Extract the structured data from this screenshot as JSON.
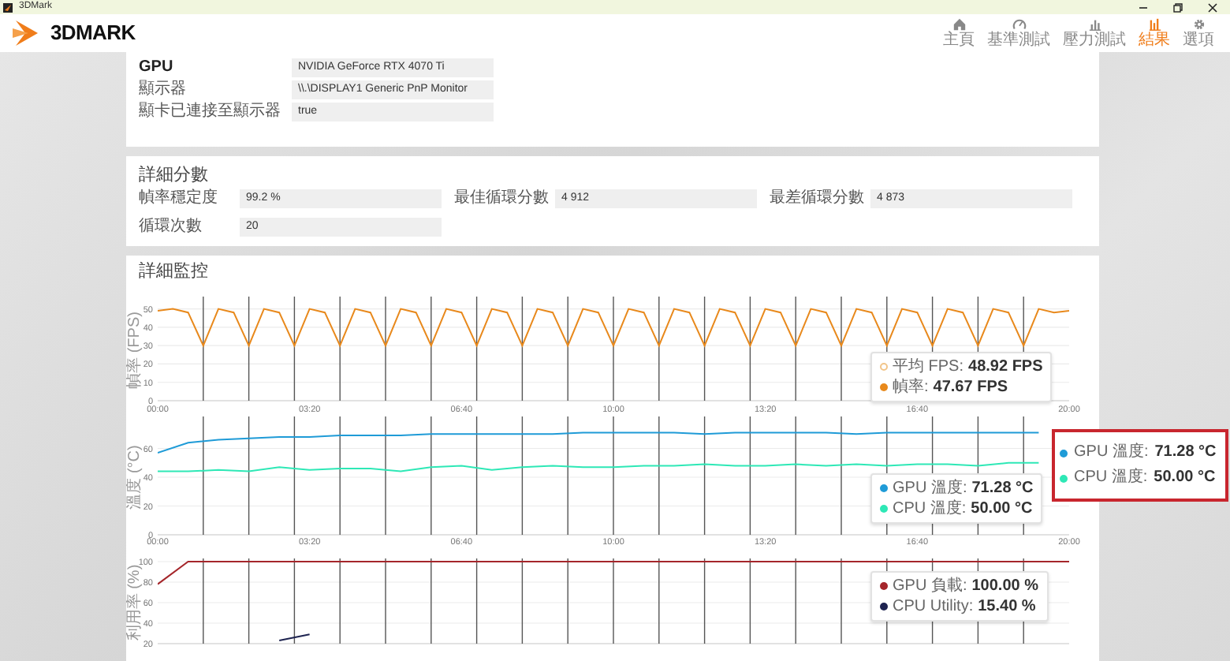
{
  "window": {
    "title": "3DMark"
  },
  "app": {
    "logo": "3DMARK"
  },
  "nav": [
    {
      "label": "主頁",
      "selected": false
    },
    {
      "label": "基準測試",
      "selected": false
    },
    {
      "label": "壓力測試",
      "selected": false
    },
    {
      "label": "結果",
      "selected": true
    },
    {
      "label": "選項",
      "selected": false
    }
  ],
  "system_info": [
    {
      "label": "GPU",
      "bold": true,
      "value": "NVIDIA GeForce RTX 4070 Ti"
    },
    {
      "label": "顯示器",
      "bold": false,
      "value": "\\\\.\\DISPLAY1 Generic PnP Monitor"
    },
    {
      "label": "顯卡已連接至顯示器",
      "bold": false,
      "value": "true"
    }
  ],
  "detailed_scores": {
    "title": "詳細分數",
    "fields": [
      {
        "label": "幀率穩定度",
        "value": "99.2 %"
      },
      {
        "label": "最佳循環分數",
        "value": "4 912"
      },
      {
        "label": "最差循環分數",
        "value": "4 873"
      },
      {
        "label": "循環次數",
        "value": "20"
      }
    ]
  },
  "monitoring": {
    "title": "詳細監控",
    "charts": [
      {
        "loop_markers": true,
        "chart_data": {
          "type": "line",
          "ylabel": "幀率 (FPS)",
          "grid": true,
          "xlim": [
            0,
            1200
          ],
          "ylim": [
            0,
            55
          ],
          "yticks": [
            0,
            10,
            20,
            30,
            40,
            50
          ],
          "x": [
            0,
            20,
            40,
            60,
            80,
            100,
            120,
            140,
            160,
            180,
            200,
            220,
            240,
            260,
            280,
            300,
            320,
            340,
            360,
            380,
            400,
            420,
            440,
            460,
            480,
            500,
            520,
            540,
            560,
            580,
            600,
            620,
            640,
            660,
            680,
            700,
            720,
            740,
            760,
            780,
            800,
            820,
            840,
            860,
            880,
            900,
            920,
            940,
            960,
            980,
            1000,
            1020,
            1040,
            1060,
            1080,
            1100,
            1120,
            1140,
            1160,
            1180,
            1200
          ],
          "xticks": [
            {
              "value": 0,
              "label": "00:00"
            },
            {
              "value": 200,
              "label": "03:20"
            },
            {
              "value": 400,
              "label": "06:40"
            },
            {
              "value": 600,
              "label": "10:00"
            },
            {
              "value": 800,
              "label": "13:20"
            },
            {
              "value": 1000,
              "label": "16:40"
            },
            {
              "value": 1200,
              "label": "20:00"
            }
          ],
          "series": [
            {
              "color": "#e8891c",
              "values": [
                49,
                50,
                48,
                30,
                50,
                48,
                30,
                50,
                48,
                30,
                50,
                48,
                30,
                50,
                48,
                30,
                50,
                48,
                30,
                50,
                48,
                30,
                50,
                48,
                30,
                50,
                48,
                30,
                50,
                48,
                30,
                50,
                48,
                30,
                50,
                48,
                30,
                50,
                48,
                30,
                50,
                48,
                30,
                50,
                48,
                30,
                50,
                48,
                30,
                50,
                48,
                30,
                50,
                48,
                30,
                50,
                48,
                30,
                50,
                48,
                49
              ]
            }
          ]
        },
        "tooltip": [
          {
            "kind": "hollow",
            "label": "平均 FPS:",
            "value": "48.92 FPS",
            "color": "#f2c58a"
          },
          {
            "kind": "filled",
            "label": "幀率:",
            "value": "47.67 FPS",
            "color": "#e8891c"
          }
        ]
      },
      {
        "loop_markers": true,
        "chart_data": {
          "type": "line",
          "ylabel": "溫度 (°C)",
          "grid": true,
          "xlim": [
            0,
            1200
          ],
          "ylim": [
            0,
            80
          ],
          "yticks": [
            0,
            20,
            40,
            60
          ],
          "x": [
            0,
            40,
            80,
            120,
            160,
            200,
            240,
            280,
            320,
            360,
            400,
            440,
            480,
            520,
            560,
            600,
            640,
            680,
            720,
            760,
            800,
            840,
            880,
            920,
            960,
            1000,
            1040,
            1080,
            1120,
            1160
          ],
          "xticks": [
            {
              "value": 0,
              "label": "00:00"
            },
            {
              "value": 200,
              "label": "03:20"
            },
            {
              "value": 400,
              "label": "06:40"
            },
            {
              "value": 600,
              "label": "10:00"
            },
            {
              "value": 800,
              "label": "13:20"
            },
            {
              "value": 1000,
              "label": "16:40"
            },
            {
              "value": 1200,
              "label": "20:00"
            }
          ],
          "series": [
            {
              "color": "#1f9bd7",
              "values": [
                57,
                64,
                66,
                67,
                68,
                68,
                69,
                69,
                69,
                70,
                70,
                70,
                70,
                70,
                71,
                71,
                71,
                71,
                70,
                71,
                71,
                71,
                71,
                70,
                71,
                71,
                71,
                71,
                71,
                71
              ]
            },
            {
              "color": "#2ee8b6",
              "values": [
                44,
                44,
                45,
                44,
                47,
                45,
                46,
                46,
                44,
                47,
                48,
                45,
                47,
                48,
                47,
                47,
                48,
                48,
                49,
                48,
                48,
                49,
                48,
                49,
                48,
                49,
                49,
                48,
                50,
                50
              ]
            }
          ]
        },
        "tooltip": [
          {
            "kind": "filled",
            "label": "GPU 溫度:",
            "value": "71.28 °C",
            "color": "#1f9bd7"
          },
          {
            "kind": "filled",
            "label": "CPU 溫度:",
            "value": "50.00 °C",
            "color": "#2ee8b6"
          }
        ]
      },
      {
        "loop_markers": true,
        "chart_data": {
          "type": "line",
          "ylabel": "利用率 (%)",
          "grid": true,
          "xlim": [
            0,
            1200
          ],
          "ylim": [
            20,
            100
          ],
          "yticks": [
            20,
            40,
            60,
            80,
            100
          ],
          "x": [
            0,
            40,
            80,
            120,
            160,
            200,
            240,
            280,
            320,
            360,
            400,
            440,
            480,
            520,
            560,
            600,
            640,
            680,
            720,
            760,
            800,
            840,
            880,
            920,
            960,
            1000,
            1040,
            1080,
            1120,
            1160,
            1200
          ],
          "series": [
            {
              "color": "#a5262b",
              "values": [
                78,
                100,
                100,
                100,
                100,
                100,
                100,
                100,
                100,
                100,
                100,
                100,
                100,
                100,
                100,
                100,
                100,
                100,
                100,
                100,
                100,
                100,
                100,
                100,
                100,
                100,
                100,
                100,
                100,
                100,
                100
              ]
            },
            {
              "color": "#1e2350",
              "values": [
                null,
                null,
                null,
                null,
                23,
                29,
                null,
                null,
                null,
                null,
                null,
                null,
                null,
                null,
                null,
                null,
                null,
                null,
                null,
                null,
                null,
                null,
                null,
                null,
                null,
                null,
                null,
                null,
                null,
                null,
                null
              ]
            }
          ]
        },
        "tooltip": [
          {
            "kind": "filled",
            "label": "GPU 負載:",
            "value": "100.00 %",
            "color": "#a5262b"
          },
          {
            "kind": "filled",
            "label": "CPU Utility:",
            "value": "15.40 %",
            "color": "#1e2350"
          }
        ]
      }
    ]
  },
  "callout": [
    {
      "label": "GPU 溫度:",
      "value": "71.28 °C",
      "color": "#1f9bd7"
    },
    {
      "label": "CPU 溫度:",
      "value": "50.00 °C",
      "color": "#2ee8b6"
    }
  ]
}
